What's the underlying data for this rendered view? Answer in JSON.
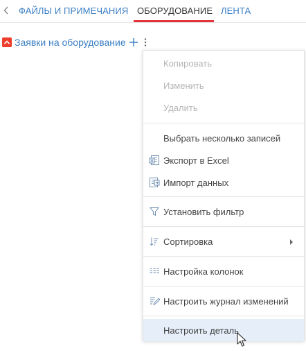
{
  "tabs": {
    "items": [
      {
        "label": "ФАЙЛЫ И ПРИМЕЧАНИЯ",
        "active": false
      },
      {
        "label": "ОБОРУДОВАНИЕ",
        "active": true
      },
      {
        "label": "ЛЕНТА",
        "active": false
      }
    ],
    "accent_color": "#e6333b",
    "link_color": "#3b7fc4"
  },
  "detail": {
    "title": "Заявки на оборудование",
    "icons": [
      "collapse-icon",
      "plus-icon",
      "kebab-icon"
    ],
    "collapse_color": "#ee3d2c"
  },
  "menu": {
    "items": [
      {
        "label": "Копировать",
        "disabled": true
      },
      {
        "label": "Изменить",
        "disabled": true
      },
      {
        "label": "Удалить",
        "disabled": true
      },
      {
        "label": "Выбрать несколько записей",
        "disabled": false
      },
      {
        "label": "Экспорт в Excel",
        "icon": "excel-export-icon",
        "disabled": false
      },
      {
        "label": "Импорт данных",
        "icon": "data-import-icon",
        "disabled": false
      },
      {
        "label": "Установить фильтр",
        "icon": "filter-icon",
        "disabled": false
      },
      {
        "label": "Сортировка",
        "icon": "sort-icon",
        "has_submenu": true,
        "disabled": false
      },
      {
        "label": "Настройка колонок",
        "icon": "columns-icon",
        "disabled": false
      },
      {
        "label": "Настроить журнал изменений",
        "icon": "change-log-icon",
        "disabled": false
      },
      {
        "label": "Настроить деталь",
        "highlighted": true,
        "disabled": false
      }
    ],
    "highlight_color": "#e5eef9",
    "disabled_color": "#b5b5b5"
  }
}
